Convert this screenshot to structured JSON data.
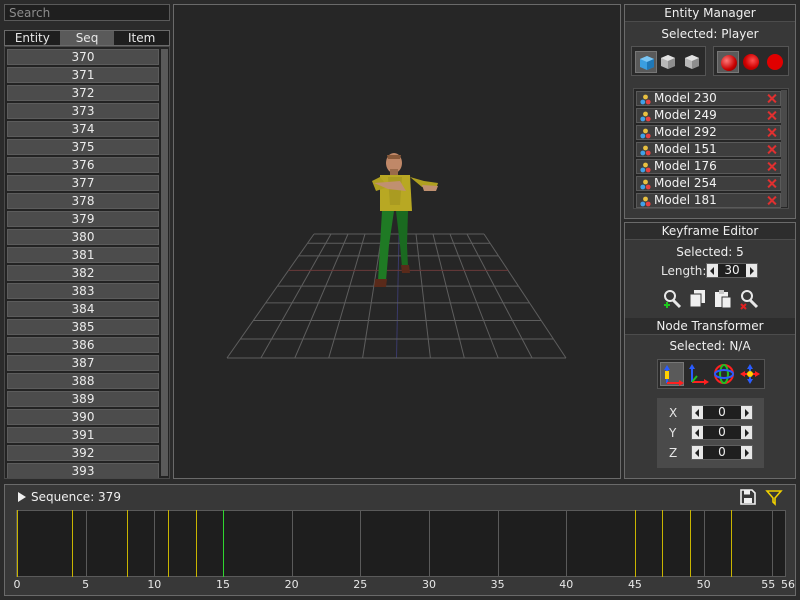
{
  "search": {
    "placeholder": "Search"
  },
  "tabs": [
    {
      "label": "Entity",
      "active": false
    },
    {
      "label": "Seq",
      "active": true
    },
    {
      "label": "Item",
      "active": false
    }
  ],
  "sequences": [
    "370",
    "371",
    "372",
    "373",
    "374",
    "375",
    "376",
    "377",
    "378",
    "379",
    "380",
    "381",
    "382",
    "383",
    "384",
    "385",
    "386",
    "387",
    "388",
    "389",
    "390",
    "391",
    "392",
    "393"
  ],
  "entity_manager": {
    "title": "Entity Manager",
    "selected": "Selected: Player",
    "icons_left": [
      "cube-blue-icon",
      "cube-grey-icon",
      "cube-grey-icon"
    ],
    "icons_right": [
      "sphere-red-icon",
      "sphere-red-faceted-icon",
      "circle-red-icon"
    ],
    "models": [
      "Model 230",
      "Model 249",
      "Model 292",
      "Model 151",
      "Model 176",
      "Model 254",
      "Model 181"
    ]
  },
  "keyframe_editor": {
    "title": "Keyframe Editor",
    "selected": "Selected: 5",
    "length_label": "Length:",
    "length_value": "30",
    "tools": [
      "zoom-add-icon",
      "copy-icon",
      "paste-icon",
      "zoom-remove-icon"
    ]
  },
  "node_transformer": {
    "title": "Node Transformer",
    "selected": "Selected: N/A",
    "modes": [
      "translate-icon",
      "axes-icon",
      "rotate-icon",
      "scale-icon"
    ],
    "x_label": "X",
    "x_value": "0",
    "y_label": "Y",
    "y_value": "0",
    "z_label": "Z",
    "z_value": "0"
  },
  "timeline": {
    "sequence_label": "Sequence: 379",
    "start": 0,
    "end": 56,
    "ticks": [
      "0",
      "5",
      "10",
      "15",
      "20",
      "25",
      "30",
      "35",
      "40",
      "45",
      "50",
      "55",
      "56"
    ],
    "keyframes_yellow": [
      0,
      4,
      8,
      11,
      13,
      45,
      47,
      49,
      52
    ],
    "keyframes_grey": [
      5,
      10,
      20,
      25,
      30,
      35,
      40,
      50,
      55
    ],
    "keyframe_green": 15,
    "colors": {
      "yellow": "#c8b400",
      "grey": "#5a5a5a",
      "green": "#2fd62f"
    }
  }
}
